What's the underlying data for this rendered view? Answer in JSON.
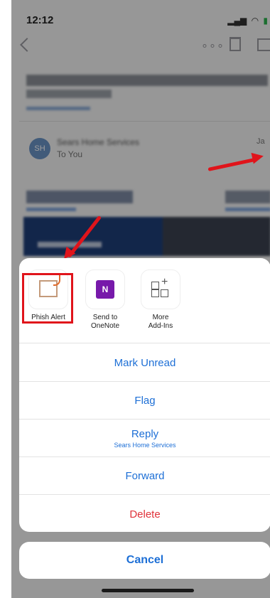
{
  "status_bar": {
    "time": "12:12",
    "icons": [
      "signal-icon",
      "wifi-icon",
      "battery-icon"
    ]
  },
  "toolbar": {
    "more_icon": "more-icon",
    "trash_icon": "trash-icon",
    "archive_icon": "archive-icon"
  },
  "email": {
    "avatar_initials": "SH",
    "sender": "Sears Home Services",
    "to": "To You",
    "date_fragment": "Ja"
  },
  "addins": [
    {
      "label": "Phish Alert",
      "icon": "phish-alert-icon"
    },
    {
      "label": "Send to\nOneNote",
      "icon": "onenote-icon"
    },
    {
      "label": "More\nAdd-Ins",
      "icon": "add-ins-icon"
    }
  ],
  "onenote_glyph": "N",
  "actions": {
    "mark_unread": "Mark Unread",
    "flag": "Flag",
    "reply": "Reply",
    "reply_sub": "Sears Home Services",
    "forward": "Forward",
    "delete": "Delete"
  },
  "cancel": "Cancel",
  "colors": {
    "accent": "#1d6fd6",
    "delete": "#e0323a",
    "annotation": "#e0141b",
    "onenote": "#7719aa"
  }
}
